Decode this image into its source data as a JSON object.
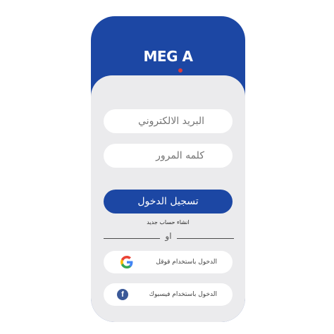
{
  "app": {
    "logo_text": "MEG A"
  },
  "form": {
    "email_placeholder": "البريد الالكتروني",
    "password_placeholder": "كلمه المرور",
    "login_label": "تسجيل الدخول",
    "create_account_label": "انشاء حساب جديد",
    "or_label": "او"
  },
  "social": {
    "google_label": "الدخول باستخدام قوقل",
    "google_icon": "google-icon",
    "facebook_label": "الدخول باستخدام فيسبوك",
    "facebook_icon": "facebook-icon"
  },
  "colors": {
    "brand": "#1c47a4",
    "card_background": "#ebebed",
    "accent": "#d93b3b"
  }
}
